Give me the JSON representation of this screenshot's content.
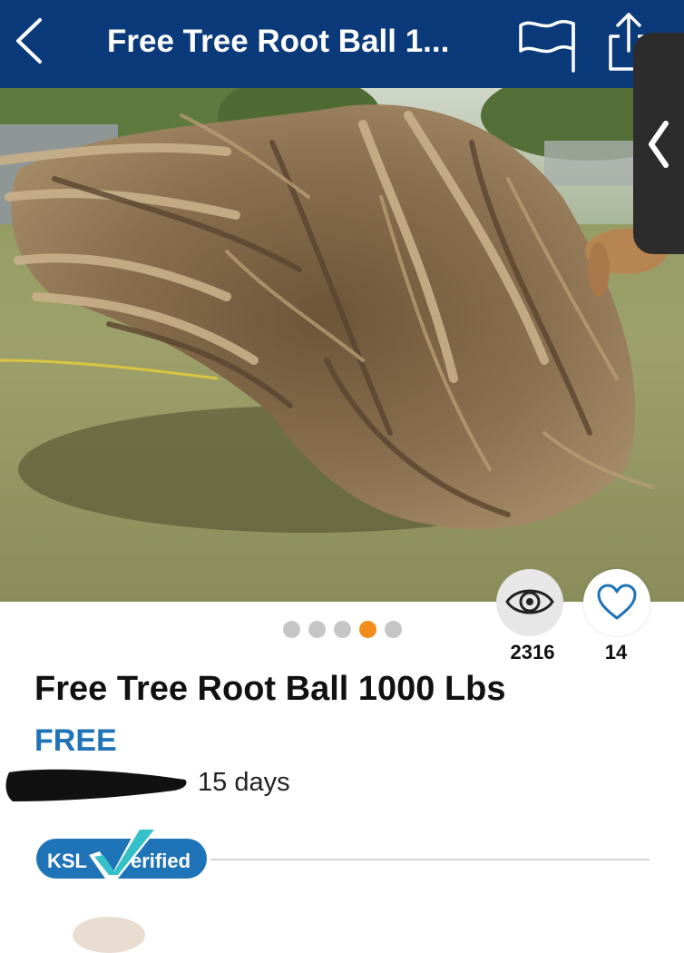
{
  "header": {
    "title": "Free Tree Root Ball 1...",
    "back_icon": "chevron-left-icon",
    "flag_icon": "flag-icon",
    "share_icon": "share-icon",
    "background": "#0a3a7a"
  },
  "gallery": {
    "image_count": 5,
    "active_index": 3,
    "active_color": "#f28c1a",
    "inactive_color": "#c6c6c6",
    "side_tab_icon": "chevron-left-icon"
  },
  "stats": {
    "views": "2316",
    "views_icon": "eye-icon",
    "favorites": "14",
    "favorites_icon": "heart-icon"
  },
  "listing": {
    "title": "Free Tree Root Ball 1000 Lbs",
    "price": "FREE",
    "price_color": "#1f73b7",
    "posted_age": "15 days"
  },
  "badge": {
    "text": "KSL",
    "verified": "erified",
    "color": "#1f73b7",
    "check_color": "#36c0c8"
  }
}
